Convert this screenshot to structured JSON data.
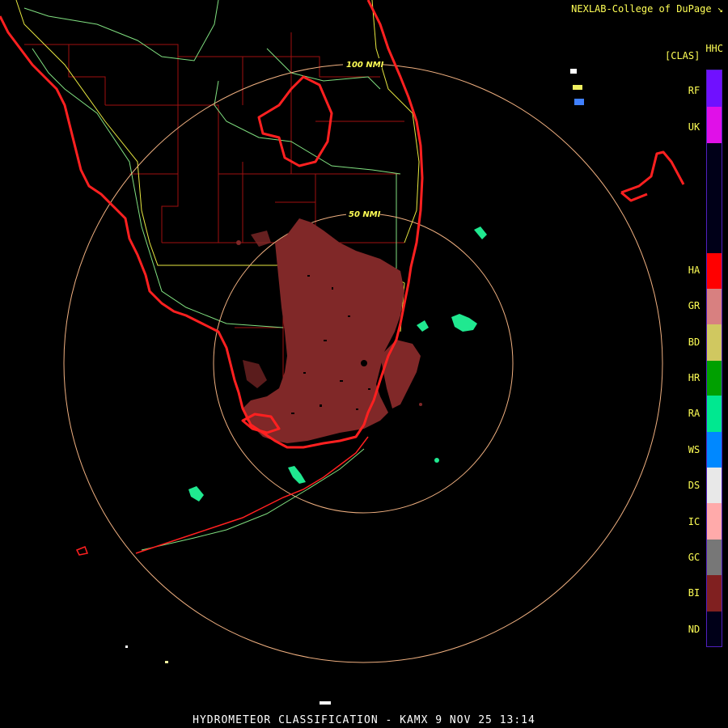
{
  "header": {
    "credit": "NEXLAB-College of DuPage",
    "product_code": "HHC",
    "product_units": "[CLAS]"
  },
  "range_rings": [
    {
      "label": "100 NMI"
    },
    {
      "label": "50 NMI"
    }
  ],
  "legend": {
    "classes": [
      {
        "code": "RF",
        "color": "#7010ff"
      },
      {
        "code": "UK",
        "color": "#e010e8"
      },
      {
        "code": "HA",
        "color": "#ff0000"
      },
      {
        "code": "GR",
        "color": "#d88080"
      },
      {
        "code": "BD",
        "color": "#d0c860"
      },
      {
        "code": "HR",
        "color": "#00a000"
      },
      {
        "code": "RA",
        "color": "#00e890"
      },
      {
        "code": "WS",
        "color": "#0088ff"
      },
      {
        "code": "DS",
        "color": "#e8e8e8"
      },
      {
        "code": "IC",
        "color": "#ffaaaa"
      },
      {
        "code": "GC",
        "color": "#777777"
      },
      {
        "code": "BI",
        "color": "#802020"
      },
      {
        "code": "ND",
        "color": "#000018"
      }
    ],
    "border_color": "#5020c0"
  },
  "footer": {
    "title": "HYDROMETEOR CLASSIFICATION - KAMX 9 NOV 25 13:14"
  }
}
